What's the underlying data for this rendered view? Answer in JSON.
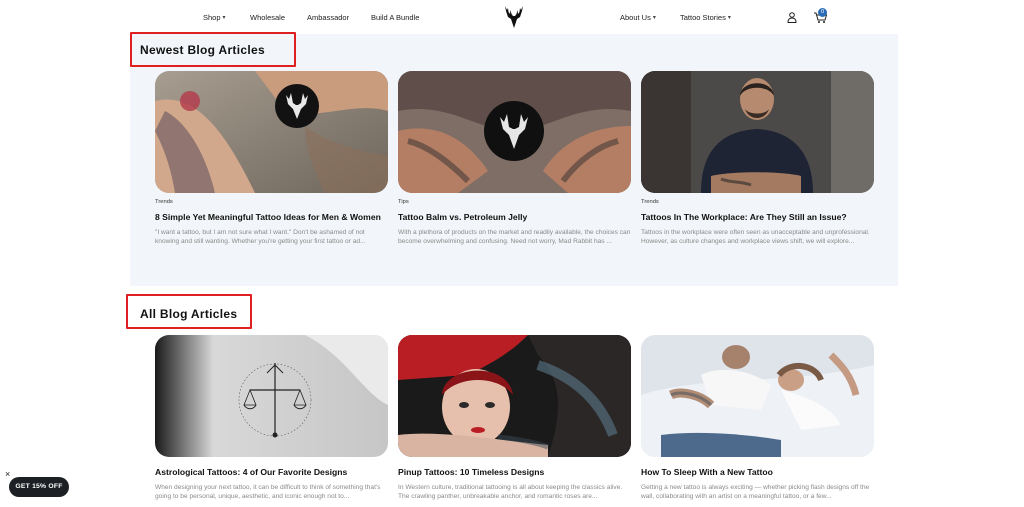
{
  "nav": {
    "shop": "Shop",
    "wholesale": "Wholesale",
    "ambassador": "Ambassador",
    "bundle": "Build A Bundle",
    "about": "About Us",
    "stories": "Tattoo Stories",
    "cart_count": "0"
  },
  "newest": {
    "title": "Newest Blog Articles",
    "cards": [
      {
        "tag": "Trends",
        "title": "8 Simple Yet Meaningful Tattoo Ideas for Men & Women",
        "excerpt": "\"I want a tattoo, but I am not sure what I want.\" Don't be ashamed of not knowing and still wanting. Whether you're getting your first tattoo or ad..."
      },
      {
        "tag": "Tips",
        "title": "Tattoo Balm vs. Petroleum Jelly",
        "excerpt": "With a plethora of products on the market and readily available, the choices can become overwhelming and confusing. Need not worry, Mad Rabbit has ..."
      },
      {
        "tag": "Trends",
        "title": "Tattoos In The Workplace: Are They Still an Issue?",
        "excerpt": "Tattoos in the workplace were often seen as unacceptable and unprofessional. However, as culture changes and workplace views shift, we will explore..."
      }
    ]
  },
  "all": {
    "title": "All Blog Articles",
    "cards": [
      {
        "title": "Astrological Tattoos: 4 of Our Favorite Designs",
        "excerpt": "When designing your next tattoo, it can be difficult to think of something that's going to be personal, unique, aesthetic, and iconic enough not to..."
      },
      {
        "title": "Pinup Tattoos: 10 Timeless Designs",
        "excerpt": "In Western culture, traditional tattooing is all about keeping the classics alive. The crawling panther, unbreakable anchor, and romantic roses are..."
      },
      {
        "title": "How To Sleep With a New Tattoo",
        "excerpt": "Getting a new tattoo is always exciting — whether picking flash designs off the wall, collaborating with an artist on a meaningful tattoo, or a few..."
      }
    ]
  },
  "promo": {
    "label": "GET 15% OFF",
    "close": "×"
  },
  "icons": [
    "stag-logo-icon",
    "user-icon",
    "cart-icon",
    "chevron-down-icon",
    "close-icon"
  ],
  "colors": {
    "highlight_box": "#e02020",
    "panel_bg": "#f2f5f9",
    "promo_bg": "#1c1f24",
    "badge": "#2a6db5"
  }
}
